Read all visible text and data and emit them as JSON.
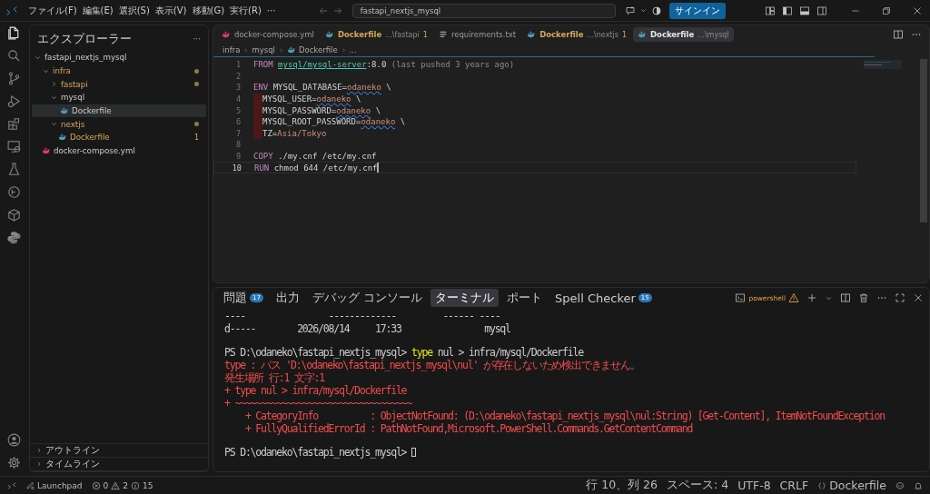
{
  "title_bar": {
    "menus": [
      "ファイル(F)",
      "編集(E)",
      "選択(S)",
      "表示(V)",
      "移動(G)",
      "実行(R)",
      "···"
    ],
    "search": "fastapi_nextjs_mysql",
    "sign_in": "サインイン"
  },
  "activity_bar": {
    "items": [
      {
        "selected": true
      },
      {
        "selected": false
      },
      {
        "selected": false
      },
      {
        "selected": false
      },
      {
        "selected": false
      },
      {
        "selected": false
      },
      {
        "selected": false
      },
      {
        "selected": false
      },
      {
        "selected": false
      },
      {
        "selected": false
      }
    ]
  },
  "sidebar": {
    "title": "エクスプローラー",
    "more": "···",
    "root": "fastapi_nextjs_mysql",
    "tree": [
      {
        "label": "infra",
        "kind": "folder",
        "expanded": true,
        "modified": true,
        "selected": false,
        "children": [
          {
            "label": "fastapi",
            "kind": "folder",
            "expanded": false,
            "modified": true,
            "selected": false
          },
          {
            "label": "mysql",
            "kind": "folder",
            "expanded": true,
            "modified": false,
            "selected": false,
            "children": [
              {
                "label": "Dockerfile",
                "kind": "file",
                "color": "#519aba",
                "modified": false,
                "selected": true
              }
            ]
          },
          {
            "label": "nextjs",
            "kind": "folder",
            "expanded": true,
            "modified": true,
            "selected": false,
            "children": [
              {
                "label": "Dockerfile",
                "kind": "file",
                "color": "#519aba",
                "modified": true,
                "count": "1",
                "selected": false
              }
            ]
          }
        ]
      },
      {
        "label": "docker-compose.yml",
        "kind": "file",
        "color": "#e3396b",
        "modified": false,
        "selected": false
      }
    ],
    "sections": [
      "アウトライン",
      "タイムライン"
    ]
  },
  "tabs": [
    {
      "label": "docker-compose.yml",
      "kind": "docker",
      "color": "#e3396b",
      "warning": false,
      "selected": false
    },
    {
      "label": "Dockerfile",
      "description": "...\\fastapi",
      "count": "1",
      "kind": "docker",
      "color": "#519aba",
      "warning": true,
      "selected": false
    },
    {
      "label": "requirements.txt",
      "kind": "text",
      "color": "#a0a0a0",
      "warning": false,
      "selected": false
    },
    {
      "label": "Dockerfile",
      "description": "...\\nextjs",
      "count": "1",
      "kind": "docker",
      "color": "#519aba",
      "warning": true,
      "selected": false
    },
    {
      "label": "Dockerfile",
      "description": "...\\mysql",
      "kind": "docker",
      "color": "#519aba",
      "warning": false,
      "selected": true
    }
  ],
  "breadcrumb": [
    "infra",
    "mysql",
    "Dockerfile",
    "..."
  ],
  "code": [
    {
      "number": "1",
      "current": false,
      "tokens": [
        {
          "text": "FROM ",
          "kind": "keyword"
        },
        {
          "text": "mysql/mysql-server",
          "kind": "image"
        },
        {
          "text": ":8.0",
          "kind": "plain"
        },
        {
          "text": " (last pushed 3 years ago)",
          "kind": "hint"
        }
      ]
    },
    {
      "number": "2",
      "current": false
    },
    {
      "number": "3",
      "current": false,
      "tokens": [
        {
          "text": "ENV ",
          "kind": "keyword"
        },
        {
          "text": "MYSQL_DATABASE=",
          "kind": "plain"
        },
        {
          "text": "odaneko",
          "kind": "spelling"
        },
        {
          "text": " \\",
          "kind": "plain"
        }
      ]
    },
    {
      "number": "4",
      "current": false,
      "marked_indent": true,
      "tokens": [
        {
          "text": "MYSQL_USER=",
          "kind": "plain"
        },
        {
          "text": "odaneko",
          "kind": "spelling"
        },
        {
          "text": " \\",
          "kind": "plain"
        }
      ]
    },
    {
      "number": "5",
      "current": false,
      "marked_indent": true,
      "tokens": [
        {
          "text": "MYSQL_PASSWORD=",
          "kind": "plain"
        },
        {
          "text": "odaneko",
          "kind": "spelling"
        },
        {
          "text": " \\",
          "kind": "plain"
        }
      ]
    },
    {
      "number": "6",
      "current": false,
      "marked_indent": true,
      "tokens": [
        {
          "text": "MYSQL_ROOT_PASSWORD=",
          "kind": "plain"
        },
        {
          "text": "odaneko",
          "kind": "spelling"
        },
        {
          "text": " \\",
          "kind": "plain"
        }
      ]
    },
    {
      "number": "7",
      "current": false,
      "marked_indent": true,
      "tokens": [
        {
          "text": "TZ=",
          "kind": "plain"
        },
        {
          "text": "Asia/Tokyo",
          "kind": "string"
        }
      ]
    },
    {
      "number": "8",
      "current": false
    },
    {
      "number": "9",
      "current": false,
      "tokens": [
        {
          "text": "COPY ",
          "kind": "keyword"
        },
        {
          "text": "./my.cnf /etc/my.cnf",
          "kind": "plain"
        }
      ]
    },
    {
      "number": "10",
      "current": true,
      "tokens": [
        {
          "text": "RUN ",
          "kind": "keyword"
        },
        {
          "text": "chmod 644 /etc/my.cnf",
          "kind": "plain"
        }
      ]
    }
  ],
  "panel": {
    "tabs": [
      {
        "label": "問題",
        "count": "17",
        "selected": false
      },
      {
        "label": "出力",
        "selected": false
      },
      {
        "label": "デバッグ コンソール",
        "selected": false
      },
      {
        "label": "ターミナル",
        "selected": true
      },
      {
        "label": "ポート",
        "selected": false
      },
      {
        "label": "Spell Checker",
        "count": "15",
        "selected": false
      }
    ],
    "shell": "powershell",
    "terminal_blocks": [
      [
        {
          "segments": [
            {
              "text": "----                -------------         ------ ----",
              "kind": "plain"
            }
          ]
        },
        {
          "segments": [
            {
              "text": "d-----        2026/08/14     17:33                mysql",
              "kind": "plain"
            }
          ]
        }
      ],
      [
        {
          "segments": [
            {
              "text": "PS D:\\odaneko\\fastapi_nextjs_mysql> ",
              "kind": "plain"
            },
            {
              "text": "type",
              "kind": "command"
            },
            {
              "text": " nul > infra/mysql/Dockerfile",
              "kind": "plain"
            }
          ]
        },
        {
          "segments": [
            {
              "text": "type : パス 'D:\\odaneko\\fastapi_nextjs_mysql\\nul' が存在しないため検出できません。",
              "kind": "error"
            }
          ]
        },
        {
          "segments": [
            {
              "text": "発生場所 行:1 文字:1",
              "kind": "error"
            }
          ]
        },
        {
          "segments": [
            {
              "text": "+ type nul > infra/mysql/Dockerfile",
              "kind": "error"
            }
          ]
        },
        {
          "segments": [
            {
              "text": "+ ~~~~~~~~~~~~~~~~~~~~~~~~~~~~~~~~~~",
              "kind": "error"
            }
          ]
        },
        {
          "segments": [
            {
              "text": "    + CategoryInfo          : ObjectNotFound: (D:\\odaneko\\fastapi_nextjs_mysql\\nul:String) [Get-Content], ItemNotFoundException",
              "kind": "error"
            }
          ]
        },
        {
          "segments": [
            {
              "text": "    + FullyQualifiedErrorId : PathNotFound,Microsoft.PowerShell.Commands.GetContentCommand",
              "kind": "error"
            }
          ]
        }
      ],
      [
        {
          "cursor": true,
          "segments": [
            {
              "text": "PS D:\\odaneko\\fastapi_nextjs_mysql> ",
              "kind": "plain"
            }
          ]
        }
      ]
    ]
  },
  "status_bar": {
    "launchpad": "Launchpad",
    "errors": "0",
    "warnings": "2",
    "infos": "15",
    "right": [
      {
        "text": "行 10、列 26"
      },
      {
        "text": "スペース: 4"
      },
      {
        "text": "UTF-8"
      },
      {
        "text": "CRLF"
      },
      {
        "text": "Dockerfile",
        "kind": "language"
      }
    ]
  }
}
